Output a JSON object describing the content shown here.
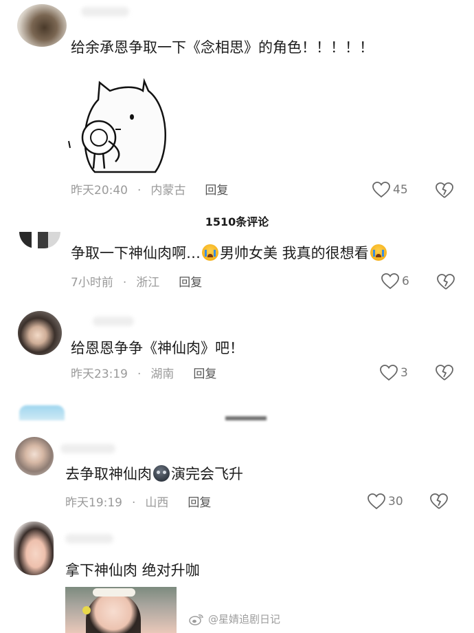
{
  "comments": [
    {
      "text": "给余承恩争取一下《念相思》的角色！！！！！",
      "time": "昨天20:40",
      "location": "内蒙古",
      "reply": "回复",
      "likes": "45"
    },
    {
      "text_a": "争取一下神仙肉啊…",
      "text_b": "男帅女美 我真的很想看",
      "time": "7小时前",
      "location": "浙江",
      "reply": "回复",
      "likes": "6"
    },
    {
      "text": "给恩恩争争《神仙肉》吧！",
      "time": "昨天23:19",
      "location": "湖南",
      "reply": "回复",
      "likes": "3"
    },
    {
      "text_a": "去争取神仙肉",
      "text_b": "演完会飞升",
      "time": "昨天19:19",
      "location": "山西",
      "reply": "回复",
      "likes": "30"
    },
    {
      "text": "拿下神仙肉 绝对升咖"
    }
  ],
  "section": {
    "comment_count": "1510条评论"
  },
  "watermark": {
    "text": "@星婧追剧日记"
  },
  "icons": {
    "like": "heart-outline-icon",
    "dislike": "broken-heart-icon",
    "emoji_cry": "loudly-crying-face-emoji",
    "emoji_dark": "new-moon-face-emoji",
    "weibo": "weibo-logo-icon"
  }
}
